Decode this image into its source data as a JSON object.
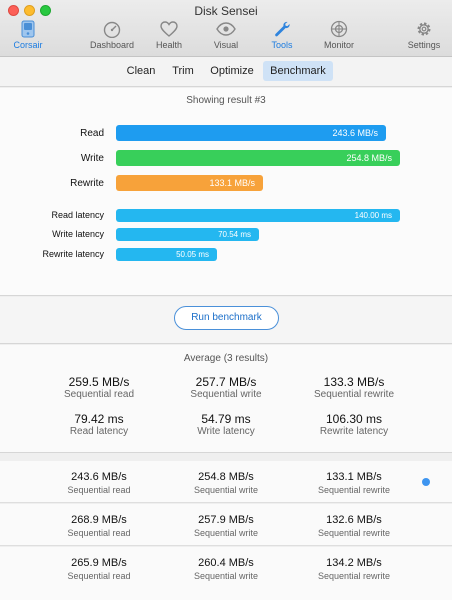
{
  "window": {
    "title": "Disk Sensei"
  },
  "toolbar": {
    "items": [
      {
        "label": "Corsair",
        "icon": "disk-icon"
      },
      {
        "label": "Dashboard",
        "icon": "speedometer-icon"
      },
      {
        "label": "Health",
        "icon": "heart-icon"
      },
      {
        "label": "Visual",
        "icon": "eye-icon"
      },
      {
        "label": "Tools",
        "icon": "wrench-icon"
      },
      {
        "label": "Monitor",
        "icon": "crosshair-icon"
      },
      {
        "label": "Settings",
        "icon": "gear-icon"
      }
    ],
    "active": "Tools"
  },
  "tabs": {
    "items": [
      "Clean",
      "Trim",
      "Optimize",
      "Benchmark"
    ],
    "active": "Benchmark"
  },
  "result": {
    "showing": "Showing result #3",
    "throughput": [
      {
        "label": "Read",
        "value": "243.6 MB/s",
        "color": "#1e9cf0"
      },
      {
        "label": "Write",
        "value": "254.8 MB/s",
        "color": "#38cf5a"
      },
      {
        "label": "Rewrite",
        "value": "133.1 MB/s",
        "color": "#f7a23a"
      }
    ],
    "latency": [
      {
        "label": "Read latency",
        "value": "140.00 ms"
      },
      {
        "label": "Write latency",
        "value": "70.54 ms"
      },
      {
        "label": "Rewrite latency",
        "value": "50.05 ms"
      }
    ]
  },
  "run_button": "Run benchmark",
  "average": {
    "title": "Average (3 results)",
    "cells": [
      {
        "value": "259.5 MB/s",
        "label": "Sequential read"
      },
      {
        "value": "257.7 MB/s",
        "label": "Sequential write"
      },
      {
        "value": "133.3 MB/s",
        "label": "Sequential rewrite"
      },
      {
        "value": "79.42 ms",
        "label": "Read latency"
      },
      {
        "value": "54.79 ms",
        "label": "Write latency"
      },
      {
        "value": "106.30 ms",
        "label": "Rewrite latency"
      }
    ]
  },
  "history": [
    {
      "cells": [
        {
          "value": "243.6 MB/s",
          "label": "Sequential read"
        },
        {
          "value": "254.8 MB/s",
          "label": "Sequential write"
        },
        {
          "value": "133.1 MB/s",
          "label": "Sequential rewrite"
        }
      ],
      "selected": true
    },
    {
      "cells": [
        {
          "value": "268.9 MB/s",
          "label": "Sequential read"
        },
        {
          "value": "257.9 MB/s",
          "label": "Sequential write"
        },
        {
          "value": "132.6 MB/s",
          "label": "Sequential rewrite"
        }
      ],
      "selected": false
    },
    {
      "cells": [
        {
          "value": "265.9 MB/s",
          "label": "Sequential read"
        },
        {
          "value": "260.4 MB/s",
          "label": "Sequential write"
        },
        {
          "value": "134.2 MB/s",
          "label": "Sequential rewrite"
        }
      ],
      "selected": false
    }
  ]
}
